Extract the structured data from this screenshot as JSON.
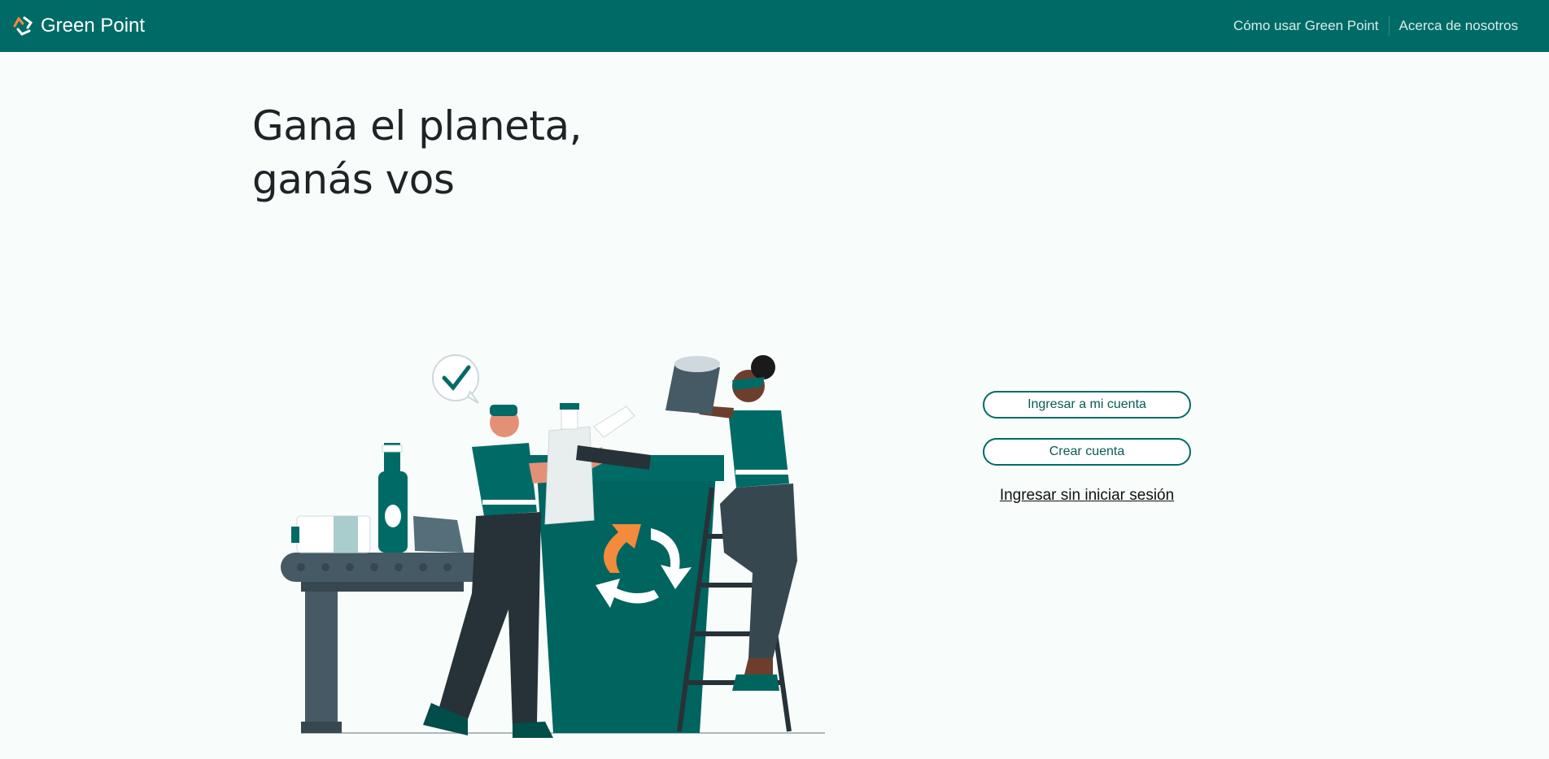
{
  "navbar": {
    "brand": "Green Point",
    "links": [
      {
        "label": "Cómo usar Green Point"
      },
      {
        "label": "Acerca de nosotros"
      }
    ]
  },
  "hero": {
    "title_line1": "Gana el planeta,",
    "title_line2": "ganás vos"
  },
  "actions": {
    "login_label": "Ingresar a mi cuenta",
    "signup_label": "Crear cuenta",
    "guest_label": "Ingresar sin iniciar sesión"
  },
  "colors": {
    "brand_primary": "#006b66",
    "accent_orange": "#f28b3b",
    "page_background": "#f8fcfb"
  },
  "icons": {
    "logo": "recycle-logo-icon",
    "illustration": "recycling-people-illustration"
  }
}
